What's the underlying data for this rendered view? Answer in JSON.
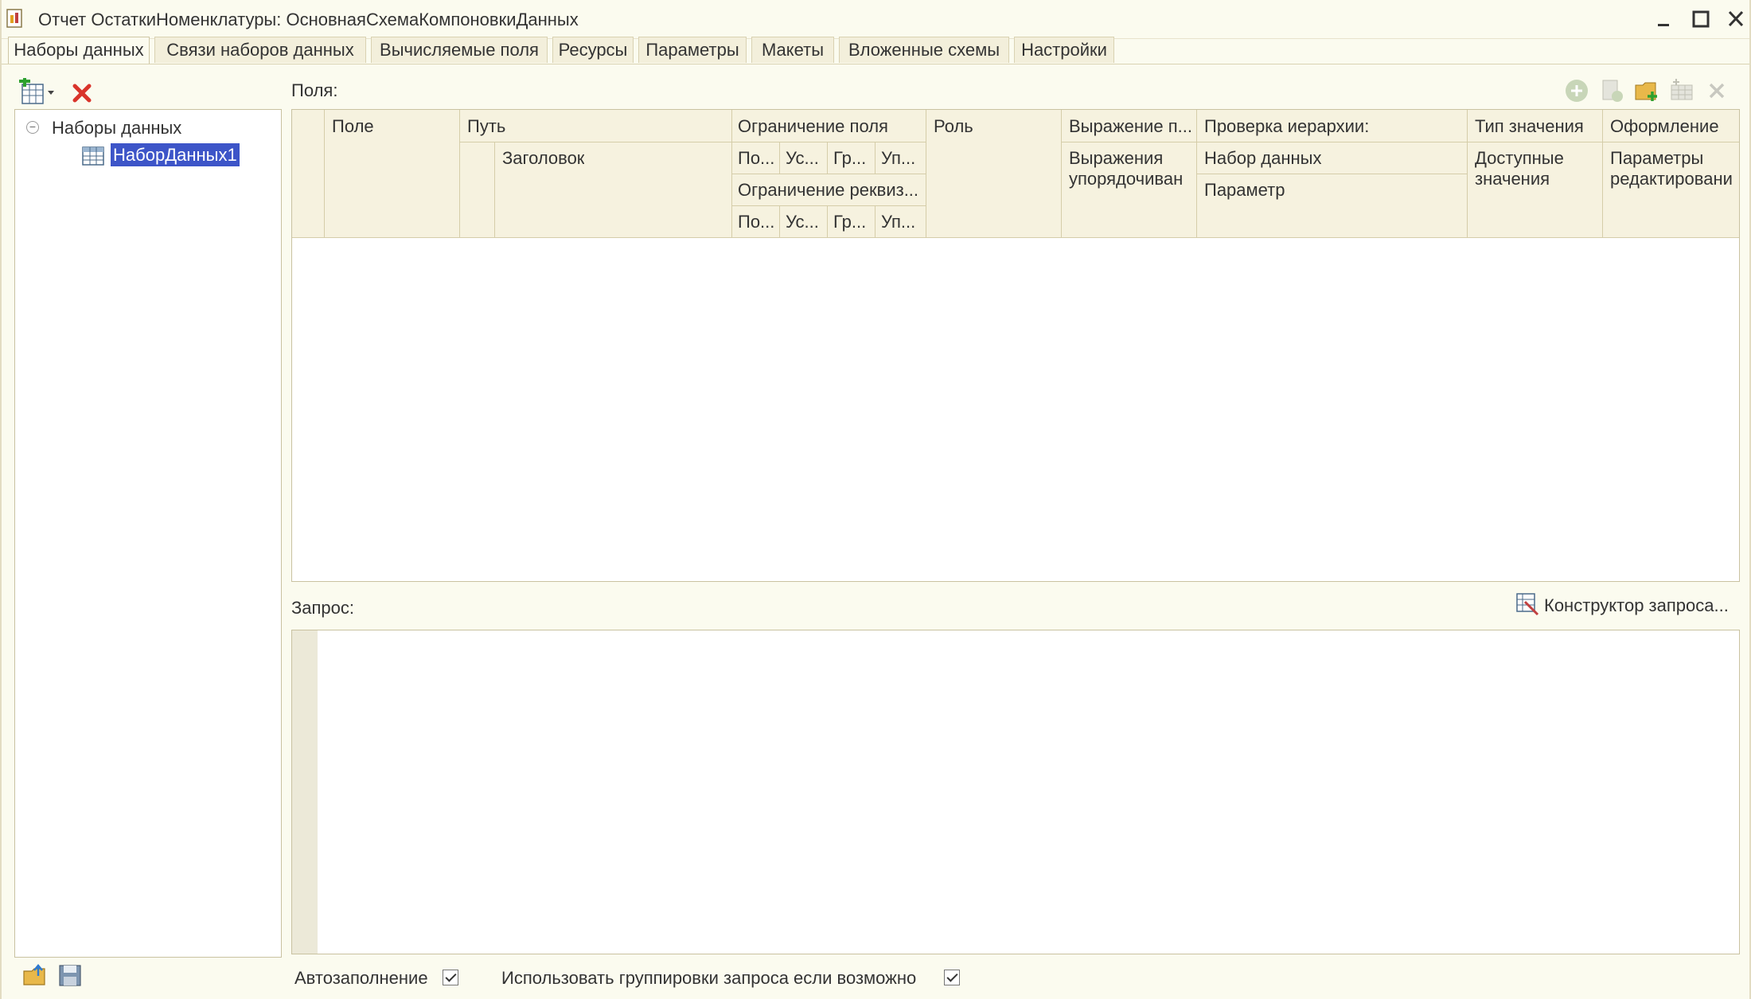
{
  "window": {
    "title": "Отчет ОстаткиНоменклатуры: ОсновнаяСхемаКомпоновкиДанных"
  },
  "tabs": [
    {
      "label": "Наборы данных",
      "active": true
    },
    {
      "label": "Связи наборов данных"
    },
    {
      "label": "Вычисляемые поля"
    },
    {
      "label": "Ресурсы"
    },
    {
      "label": "Параметры"
    },
    {
      "label": "Макеты"
    },
    {
      "label": "Вложенные схемы"
    },
    {
      "label": "Настройки"
    }
  ],
  "tree": {
    "root": "Наборы данных",
    "child": "НаборДанных1"
  },
  "fields": {
    "label": "Поля:",
    "headers": {
      "field": "Поле",
      "path": "Путь",
      "title": "Заголовок",
      "field_restriction": "Ограничение поля",
      "attr_restriction": "Ограничение реквиз...",
      "sub_po": "По...",
      "sub_us": "Ус...",
      "sub_gr": "Гр...",
      "sub_up": "Уп...",
      "role": "Роль",
      "expression": "Выражение п...",
      "order_expr": "Выражения упорядочиван",
      "hierarchy": "Проверка иерархии:",
      "dataset": "Набор данных",
      "parameter": "Параметр",
      "value_type": "Тип значения",
      "available_values": "Доступные значения",
      "appearance": "Оформление",
      "edit_params": "Параметры редактировани"
    }
  },
  "query": {
    "label": "Запрос:",
    "constructor_button": "Конструктор запроса..."
  },
  "footer": {
    "autofill_label": "Автозаполнение",
    "autofill_checked": true,
    "use_grouping_label": "Использовать группировки запроса если возможно",
    "use_grouping_checked": true
  },
  "colors": {
    "background": "#fbfbef",
    "header": "#f6f2df",
    "selection": "#3d55c8",
    "delete_red": "#d9342b"
  }
}
